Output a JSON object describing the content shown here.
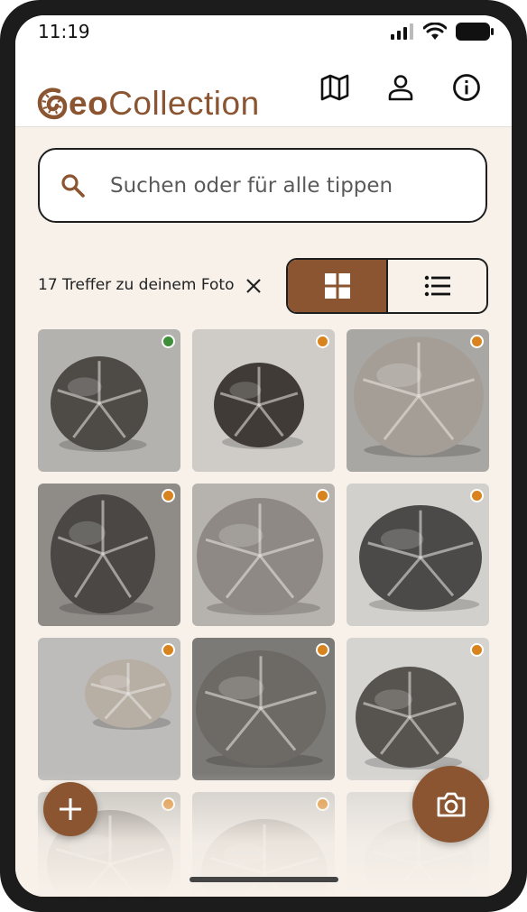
{
  "status_bar": {
    "time": "11:19",
    "icons": [
      "signal-icon",
      "wifi-icon",
      "battery-icon"
    ]
  },
  "app_bar": {
    "logo": {
      "prefix": "eo",
      "suffix": "Collection",
      "icon": "ammonite-icon"
    },
    "actions": [
      {
        "name": "map",
        "icon": "map-icon"
      },
      {
        "name": "account",
        "icon": "person-icon"
      },
      {
        "name": "info",
        "icon": "info-icon"
      }
    ]
  },
  "search": {
    "placeholder": "Suchen oder für alle tippen",
    "value": ""
  },
  "results": {
    "text": "17 Treffer zu deinem Foto",
    "clear_icon": "close-icon"
  },
  "view_toggle": {
    "options": [
      {
        "icon": "grid-icon",
        "selected": true
      },
      {
        "icon": "list-icon",
        "selected": false
      }
    ]
  },
  "grid": {
    "items": [
      {
        "dot": "green"
      },
      {
        "dot": "orange"
      },
      {
        "dot": "orange"
      },
      {
        "dot": "orange"
      },
      {
        "dot": "orange"
      },
      {
        "dot": "orange"
      },
      {
        "dot": "orange"
      },
      {
        "dot": "orange"
      },
      {
        "dot": "orange"
      },
      {
        "dot": "orange"
      },
      {
        "dot": "orange"
      },
      {
        "dot": "none"
      }
    ]
  },
  "fabs": {
    "add": "plus-icon",
    "camera": "camera-icon"
  },
  "colors": {
    "brand": "#8a5530",
    "background": "#f7f1ea",
    "dot_green": "#3e8e3a",
    "dot_orange": "#d9831e"
  }
}
